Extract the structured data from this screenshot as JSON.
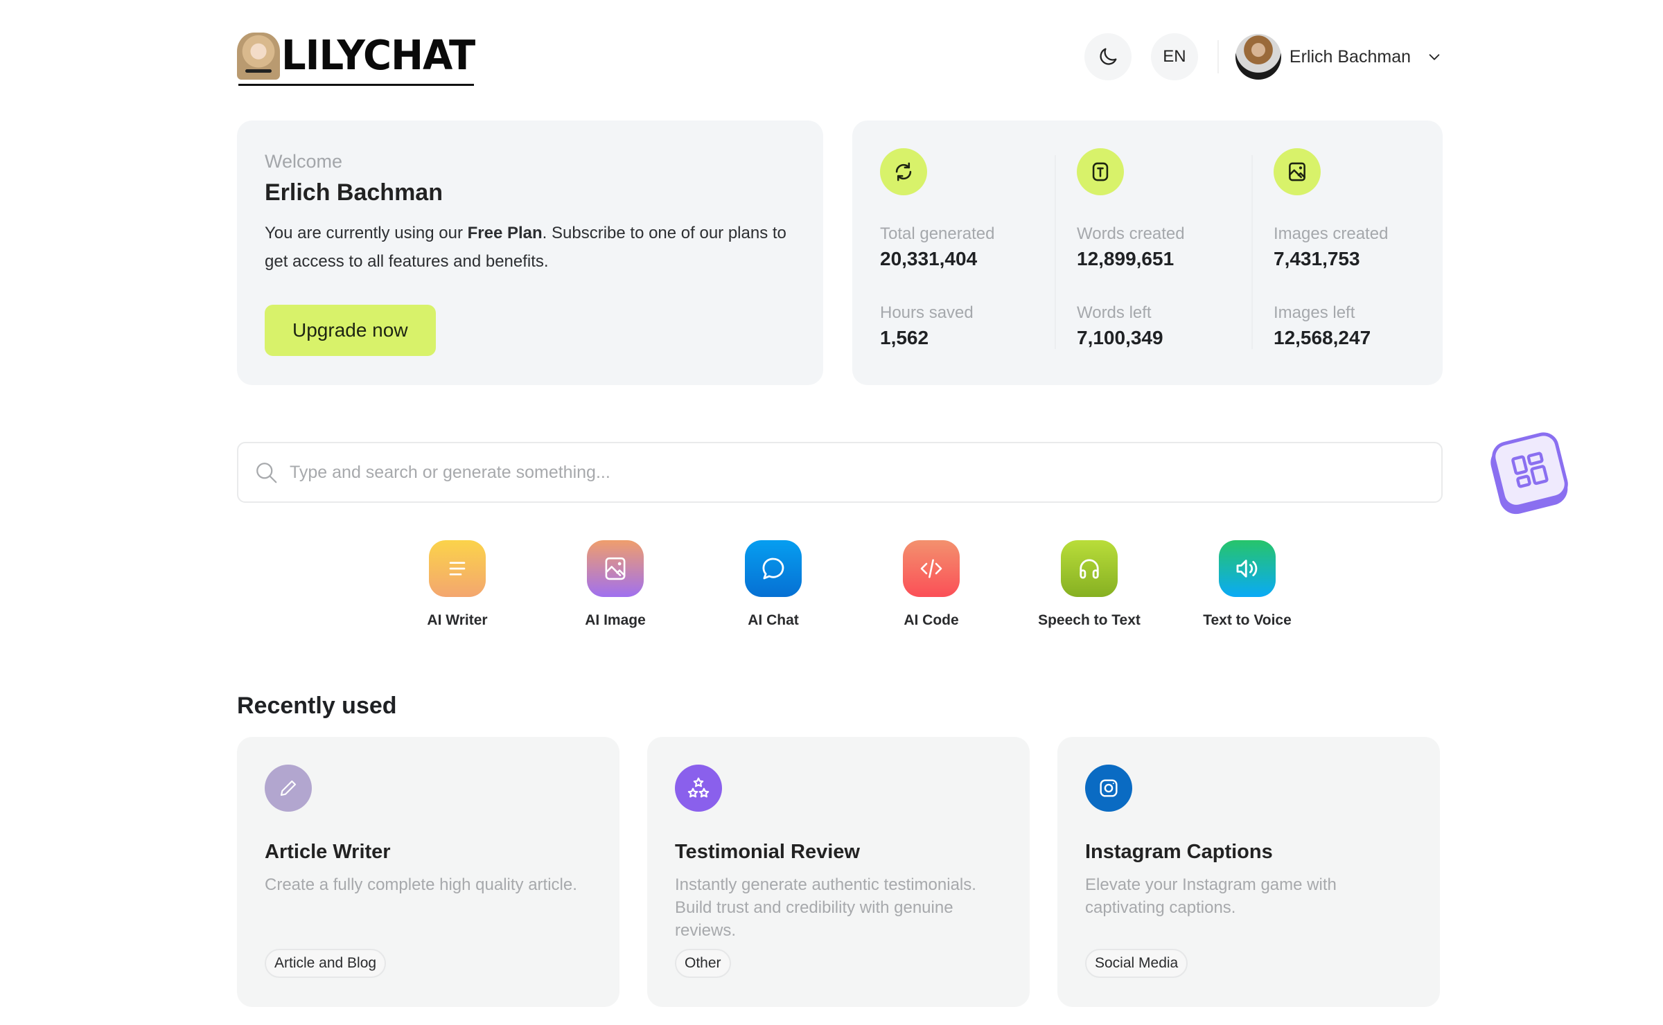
{
  "header": {
    "brand": "LILYCHAT",
    "theme_toggle_icon": "moon-icon",
    "language": "EN",
    "user_name": "Erlich Bachman",
    "user_menu_icon": "chevron-down-icon"
  },
  "welcome": {
    "label": "Welcome",
    "name": "Erlich Bachman",
    "text_before": "You are currently using our ",
    "plan": "Free Plan",
    "text_after": ". Subscribe to one of our plans to get access to all features and benefits.",
    "upgrade_label": "Upgrade now",
    "accent_color": "#d8f26a"
  },
  "stats": {
    "columns": [
      {
        "icon": "refresh-icon",
        "items": [
          {
            "label": "Total generated",
            "value": "20,331,404"
          },
          {
            "label": "Hours saved",
            "value": "1,562"
          }
        ]
      },
      {
        "icon": "text-box-icon",
        "items": [
          {
            "label": "Words created",
            "value": "12,899,651"
          },
          {
            "label": "Words left",
            "value": "7,100,349"
          }
        ]
      },
      {
        "icon": "image-icon",
        "items": [
          {
            "label": "Images created",
            "value": "7,431,753"
          },
          {
            "label": "Images left",
            "value": "12,568,247"
          }
        ]
      }
    ]
  },
  "search": {
    "placeholder": "Type and search or generate something...",
    "value": ""
  },
  "apps_button_icon": "grid-apps-icon",
  "tools": [
    {
      "label": "AI Writer",
      "icon": "lines-icon",
      "colors": [
        "#fbd34a",
        "#f3a66f"
      ]
    },
    {
      "label": "AI Image",
      "icon": "image-icon",
      "colors": [
        "#ef9e6c",
        "#a070ef"
      ]
    },
    {
      "label": "AI Chat",
      "icon": "chat-bubble-icon",
      "colors": [
        "#069ef0",
        "#0670d3"
      ]
    },
    {
      "label": "AI Code",
      "icon": "code-icon",
      "colors": [
        "#f3916e",
        "#fb4f57"
      ]
    },
    {
      "label": "Speech to Text",
      "icon": "headphones-icon",
      "colors": [
        "#b9dd3a",
        "#86b022"
      ]
    },
    {
      "label": "Text to Voice",
      "icon": "speaker-icon",
      "colors": [
        "#27c46a",
        "#0aaaf6"
      ]
    }
  ],
  "recent": {
    "title": "Recently used",
    "items": [
      {
        "title": "Article Writer",
        "description": "Create a fully complete high quality article.",
        "tag": "Article and Blog",
        "icon": "pencil-icon",
        "color": "#b2a6cf"
      },
      {
        "title": "Testimonial Review",
        "description": "Instantly generate authentic testimonials. Build trust and credibility with genuine reviews.",
        "tag": "Other",
        "icon": "stars-icon",
        "color": "#8a60ec"
      },
      {
        "title": "Instagram Captions",
        "description": "Elevate your Instagram game with captivating captions.",
        "tag": "Social Media",
        "icon": "instagram-icon",
        "color": "#0a6bc3"
      }
    ]
  }
}
